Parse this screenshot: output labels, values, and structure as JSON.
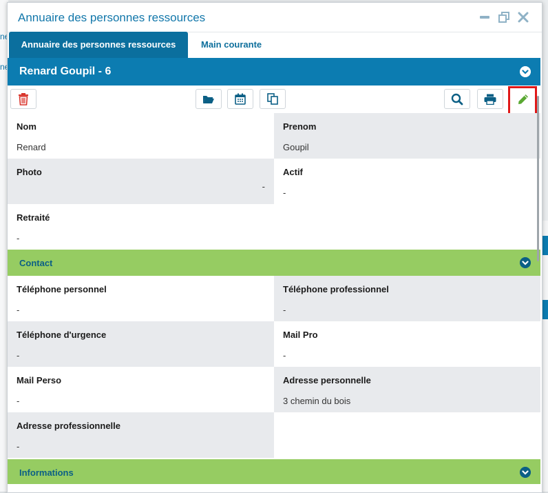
{
  "background": {
    "left_fragments": [
      "ne",
      "ne"
    ]
  },
  "dialog": {
    "title": "Annuaire des personnes ressources",
    "controls": [
      "minimize-icon",
      "restore-icon",
      "close-icon"
    ]
  },
  "tabs": [
    {
      "label": "Annuaire des personnes ressources",
      "active": true
    },
    {
      "label": "Main courante",
      "active": false
    }
  ],
  "record": {
    "title": "Renard Goupil - 6"
  },
  "toolbar": {
    "buttons": [
      "trash-icon",
      "folder-open-icon",
      "calendar-icon",
      "copy-icon",
      "search-icon",
      "print-icon",
      "pencil-icon"
    ]
  },
  "fields": {
    "nom": {
      "label": "Nom",
      "value": "Renard"
    },
    "prenom": {
      "label": "Prenom",
      "value": "Goupil"
    },
    "photo": {
      "label": "Photo",
      "value": "-"
    },
    "actif": {
      "label": "Actif",
      "value": "-"
    },
    "retraite": {
      "label": "Retraité",
      "value": "-"
    }
  },
  "contact": {
    "title": "Contact",
    "fields": {
      "tel_perso": {
        "label": "Téléphone personnel",
        "value": "-"
      },
      "tel_pro": {
        "label": "Téléphone professionnel",
        "value": "-"
      },
      "tel_urgence": {
        "label": "Téléphone d'urgence",
        "value": "-"
      },
      "mail_pro": {
        "label": "Mail Pro",
        "value": "-"
      },
      "mail_perso": {
        "label": "Mail Perso",
        "value": "-"
      },
      "adresse_perso": {
        "label": "Adresse personnelle",
        "value": "3 chemin du bois"
      },
      "adresse_pro": {
        "label": "Adresse professionnelle",
        "value": "-"
      }
    }
  },
  "informations": {
    "title": "Informations"
  },
  "colors": {
    "primary": "#0c7cb1",
    "tab_active": "#0b6f9e",
    "section_green": "#96cc62",
    "delete_red": "#d9342b",
    "edit_green": "#5aa832",
    "highlight_red": "#e01818"
  }
}
